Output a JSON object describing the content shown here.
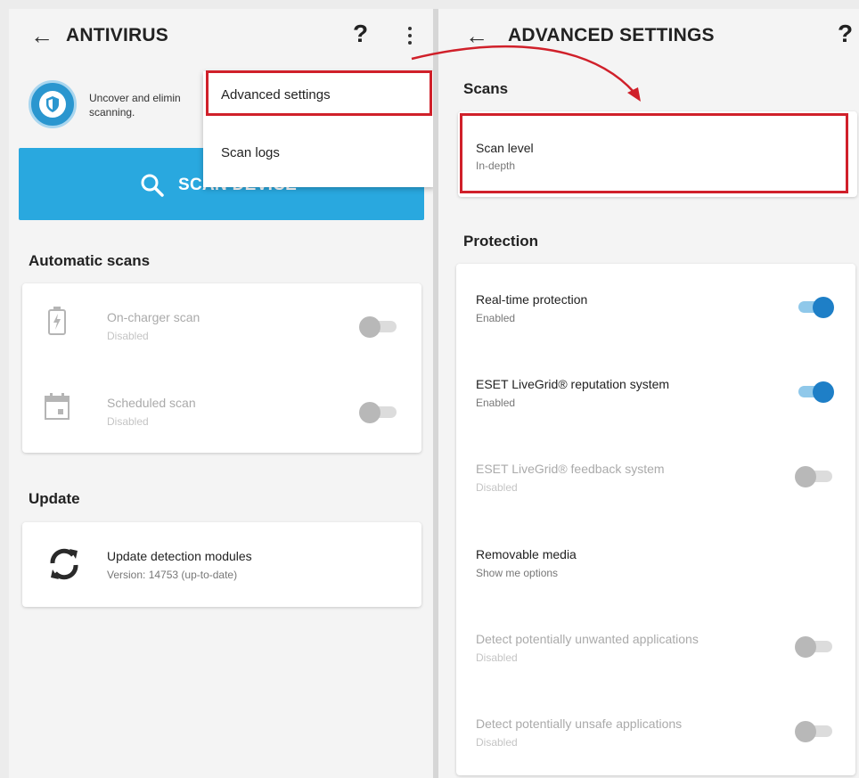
{
  "left_screen": {
    "back_icon": "back-arrow-icon",
    "title": "ANTIVIRUS",
    "help": "?",
    "description": "Uncover and elimin scanning.",
    "scan_button": "SCAN DEVICE",
    "automatic_scans": {
      "heading": "Automatic scans",
      "items": [
        {
          "title": "On-charger scan",
          "status": "Disabled",
          "icon": "battery-charging-icon"
        },
        {
          "title": "Scheduled scan",
          "status": "Disabled",
          "icon": "calendar-icon"
        }
      ]
    },
    "update": {
      "heading": "Update",
      "title": "Update detection modules",
      "version": "Version: 14753 (up-to-date)",
      "icon": "refresh-icon"
    },
    "menu": {
      "items": [
        "Advanced settings",
        "Scan logs"
      ]
    }
  },
  "right_screen": {
    "back_icon": "back-arrow-icon",
    "title": "ADVANCED SETTINGS",
    "help": "?",
    "scans": {
      "heading": "Scans",
      "scan_level_title": "Scan level",
      "scan_level_value": "In-depth"
    },
    "protection": {
      "heading": "Protection",
      "items": [
        {
          "title": "Real-time protection",
          "status": "Enabled"
        },
        {
          "title": "ESET LiveGrid® reputation system",
          "status": "Enabled"
        },
        {
          "title": "ESET LiveGrid® feedback system",
          "status": "Disabled"
        },
        {
          "title": "Removable media",
          "status": "Show me options"
        },
        {
          "title": "Detect potentially unwanted applications",
          "status": "Disabled"
        },
        {
          "title": "Detect potentially unsafe applications",
          "status": "Disabled"
        }
      ]
    }
  },
  "colors": {
    "accent": "#29a8df",
    "toggle_on": "#1e7fc7",
    "highlight": "#d0202a"
  }
}
